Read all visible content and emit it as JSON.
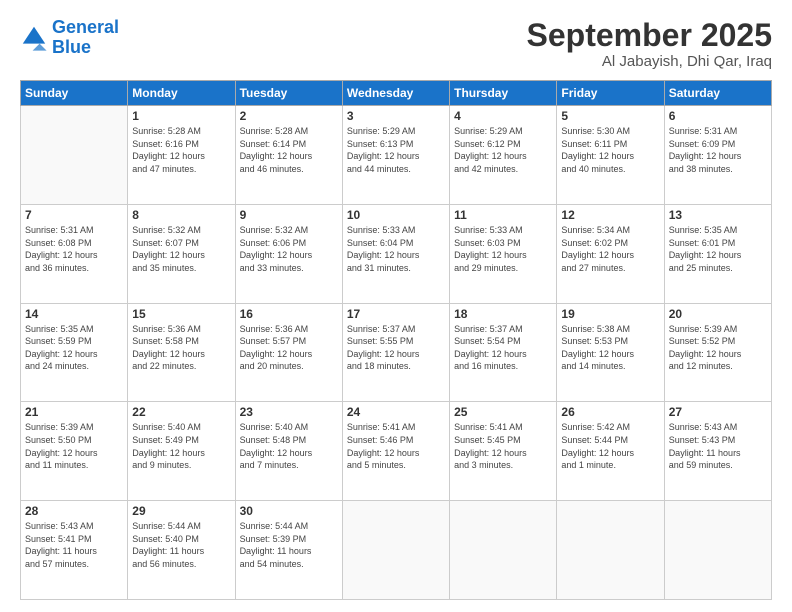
{
  "header": {
    "logo_line1": "General",
    "logo_line2": "Blue",
    "month": "September 2025",
    "location": "Al Jabayish, Dhi Qar, Iraq"
  },
  "weekdays": [
    "Sunday",
    "Monday",
    "Tuesday",
    "Wednesday",
    "Thursday",
    "Friday",
    "Saturday"
  ],
  "weeks": [
    [
      {
        "day": "",
        "text": ""
      },
      {
        "day": "1",
        "text": "Sunrise: 5:28 AM\nSunset: 6:16 PM\nDaylight: 12 hours\nand 47 minutes."
      },
      {
        "day": "2",
        "text": "Sunrise: 5:28 AM\nSunset: 6:14 PM\nDaylight: 12 hours\nand 46 minutes."
      },
      {
        "day": "3",
        "text": "Sunrise: 5:29 AM\nSunset: 6:13 PM\nDaylight: 12 hours\nand 44 minutes."
      },
      {
        "day": "4",
        "text": "Sunrise: 5:29 AM\nSunset: 6:12 PM\nDaylight: 12 hours\nand 42 minutes."
      },
      {
        "day": "5",
        "text": "Sunrise: 5:30 AM\nSunset: 6:11 PM\nDaylight: 12 hours\nand 40 minutes."
      },
      {
        "day": "6",
        "text": "Sunrise: 5:31 AM\nSunset: 6:09 PM\nDaylight: 12 hours\nand 38 minutes."
      }
    ],
    [
      {
        "day": "7",
        "text": "Sunrise: 5:31 AM\nSunset: 6:08 PM\nDaylight: 12 hours\nand 36 minutes."
      },
      {
        "day": "8",
        "text": "Sunrise: 5:32 AM\nSunset: 6:07 PM\nDaylight: 12 hours\nand 35 minutes."
      },
      {
        "day": "9",
        "text": "Sunrise: 5:32 AM\nSunset: 6:06 PM\nDaylight: 12 hours\nand 33 minutes."
      },
      {
        "day": "10",
        "text": "Sunrise: 5:33 AM\nSunset: 6:04 PM\nDaylight: 12 hours\nand 31 minutes."
      },
      {
        "day": "11",
        "text": "Sunrise: 5:33 AM\nSunset: 6:03 PM\nDaylight: 12 hours\nand 29 minutes."
      },
      {
        "day": "12",
        "text": "Sunrise: 5:34 AM\nSunset: 6:02 PM\nDaylight: 12 hours\nand 27 minutes."
      },
      {
        "day": "13",
        "text": "Sunrise: 5:35 AM\nSunset: 6:01 PM\nDaylight: 12 hours\nand 25 minutes."
      }
    ],
    [
      {
        "day": "14",
        "text": "Sunrise: 5:35 AM\nSunset: 5:59 PM\nDaylight: 12 hours\nand 24 minutes."
      },
      {
        "day": "15",
        "text": "Sunrise: 5:36 AM\nSunset: 5:58 PM\nDaylight: 12 hours\nand 22 minutes."
      },
      {
        "day": "16",
        "text": "Sunrise: 5:36 AM\nSunset: 5:57 PM\nDaylight: 12 hours\nand 20 minutes."
      },
      {
        "day": "17",
        "text": "Sunrise: 5:37 AM\nSunset: 5:55 PM\nDaylight: 12 hours\nand 18 minutes."
      },
      {
        "day": "18",
        "text": "Sunrise: 5:37 AM\nSunset: 5:54 PM\nDaylight: 12 hours\nand 16 minutes."
      },
      {
        "day": "19",
        "text": "Sunrise: 5:38 AM\nSunset: 5:53 PM\nDaylight: 12 hours\nand 14 minutes."
      },
      {
        "day": "20",
        "text": "Sunrise: 5:39 AM\nSunset: 5:52 PM\nDaylight: 12 hours\nand 12 minutes."
      }
    ],
    [
      {
        "day": "21",
        "text": "Sunrise: 5:39 AM\nSunset: 5:50 PM\nDaylight: 12 hours\nand 11 minutes."
      },
      {
        "day": "22",
        "text": "Sunrise: 5:40 AM\nSunset: 5:49 PM\nDaylight: 12 hours\nand 9 minutes."
      },
      {
        "day": "23",
        "text": "Sunrise: 5:40 AM\nSunset: 5:48 PM\nDaylight: 12 hours\nand 7 minutes."
      },
      {
        "day": "24",
        "text": "Sunrise: 5:41 AM\nSunset: 5:46 PM\nDaylight: 12 hours\nand 5 minutes."
      },
      {
        "day": "25",
        "text": "Sunrise: 5:41 AM\nSunset: 5:45 PM\nDaylight: 12 hours\nand 3 minutes."
      },
      {
        "day": "26",
        "text": "Sunrise: 5:42 AM\nSunset: 5:44 PM\nDaylight: 12 hours\nand 1 minute."
      },
      {
        "day": "27",
        "text": "Sunrise: 5:43 AM\nSunset: 5:43 PM\nDaylight: 11 hours\nand 59 minutes."
      }
    ],
    [
      {
        "day": "28",
        "text": "Sunrise: 5:43 AM\nSunset: 5:41 PM\nDaylight: 11 hours\nand 57 minutes."
      },
      {
        "day": "29",
        "text": "Sunrise: 5:44 AM\nSunset: 5:40 PM\nDaylight: 11 hours\nand 56 minutes."
      },
      {
        "day": "30",
        "text": "Sunrise: 5:44 AM\nSunset: 5:39 PM\nDaylight: 11 hours\nand 54 minutes."
      },
      {
        "day": "",
        "text": ""
      },
      {
        "day": "",
        "text": ""
      },
      {
        "day": "",
        "text": ""
      },
      {
        "day": "",
        "text": ""
      }
    ]
  ]
}
